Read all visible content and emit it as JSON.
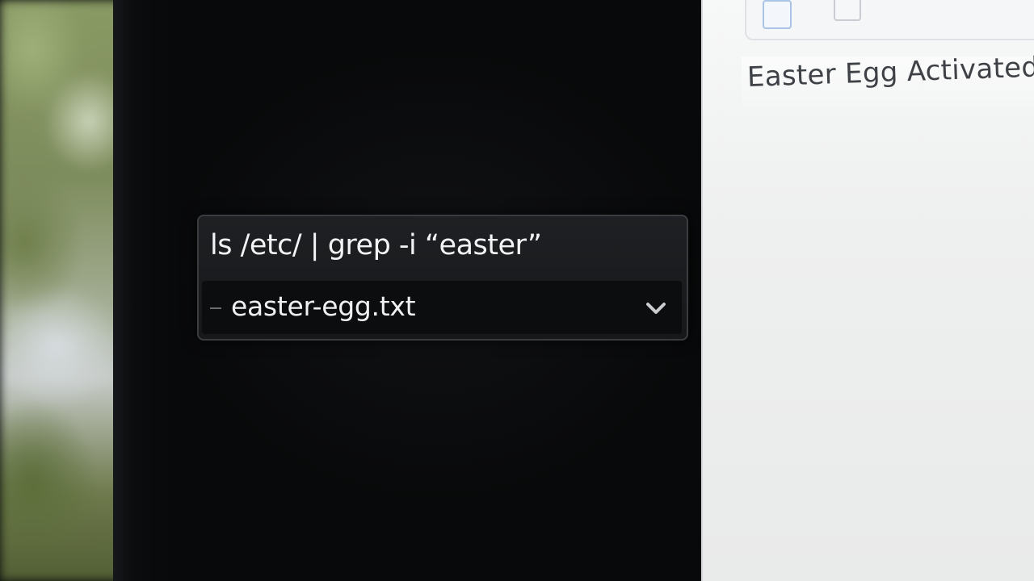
{
  "terminal": {
    "command": "ls /etc/ | grep -i “easter”",
    "result": {
      "marker": "–",
      "filename": "easter-egg.txt",
      "icon": "chevron-down-icon"
    }
  },
  "side_panel": {
    "notice": "Easter Egg Activated",
    "controls": [
      "checkbox-icon",
      "checkbox-icon"
    ]
  },
  "colors": {
    "terminal_bg": "#0a0b0c",
    "command_box_bg": "#1e2023",
    "panel_bg": "#f2f3f3",
    "notice_text": "#3e4247"
  }
}
